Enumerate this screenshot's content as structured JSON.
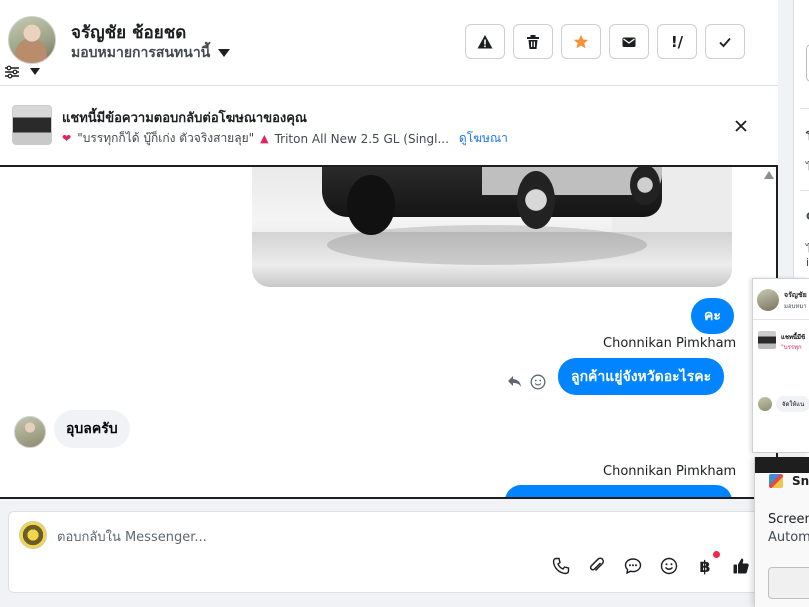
{
  "header": {
    "contact_name": "จรัญชัย ช้อยชด",
    "assign_label": "มอบหมายการสนทนานี้",
    "tools": [
      {
        "icon": "alert-icon"
      },
      {
        "icon": "trash-icon"
      },
      {
        "icon": "star-icon",
        "color": "#f7923a"
      },
      {
        "icon": "envelope-icon"
      },
      {
        "icon": "follow-up-icon",
        "label": "!/"
      },
      {
        "icon": "check-icon"
      }
    ]
  },
  "ad_banner": {
    "title": "แชทนี้มีข้อความตอบกลับต่อโฆษณาของคุณ",
    "quote": "\"บรรทุกก็ได้ บู๊ก็เก่ง ตัวจริงสายลุย\"",
    "car_text": "Triton All New 2.5 GL (Singl...",
    "link": "ดูโฆษณา"
  },
  "messages": {
    "out_1": "คะ",
    "sender_1": "Chonnikan Pimkham",
    "out_2": "ลูกค้าแยู่จังหวัดอะไรคะ",
    "in_1": "อุบลครับ",
    "sender_2": "Chonnikan Pimkham"
  },
  "composer": {
    "placeholder": "ตอบกลับใน Messenger...",
    "baht_symbol": "฿"
  },
  "right_panel": {
    "line1": "โ",
    "line2": "ไ",
    "line3": "C",
    "line4": "ไ",
    "line5": "i"
  },
  "mini_window": {
    "name": "จรัญชัย ช้",
    "sub": "มอบหมา",
    "ad_title": "แชทนี้มีข้",
    "ad_quote": "\"บรรทุก",
    "in_message": "จัดให้แน"
  },
  "notification": {
    "app": "Sni",
    "title": "Screen",
    "body": "Autom"
  },
  "colors": {
    "accent": "#0084ff",
    "link": "#1877f2",
    "star": "#f7923a",
    "badge_dot": "#f02849"
  }
}
